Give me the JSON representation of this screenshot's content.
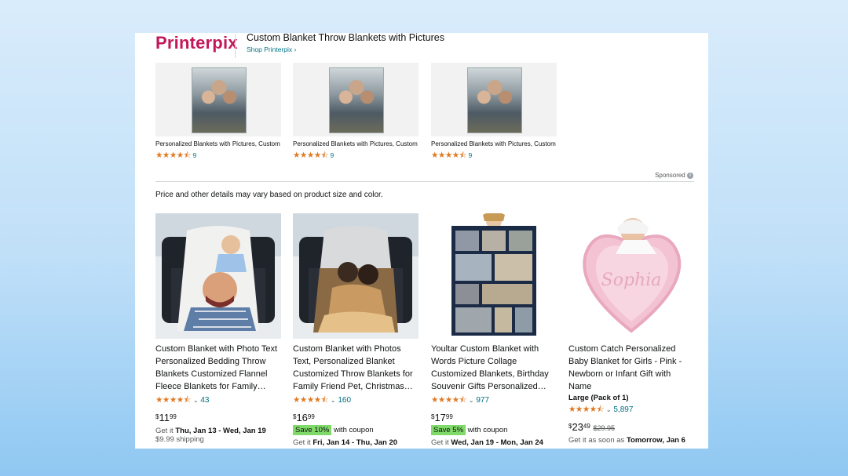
{
  "brand": {
    "logo_text": "Printerpix",
    "title": "Custom Blanket Throw Blankets with Pictures",
    "shop_link": "Shop Printerpix ›",
    "logo_color": "#c2185b"
  },
  "sponsored_items": [
    {
      "title": "Personalized Blankets with Pictures, Custom Throw Blanket, Soft Sherpa, for…",
      "stars": "★★★★⯪",
      "rating_count": "9"
    },
    {
      "title": "Personalized Blankets with Pictures, Custom Throw Blanket, Soft Sherpa, for…",
      "stars": "★★★★⯪",
      "rating_count": "9"
    },
    {
      "title": "Personalized Blankets with Pictures, Custom Throw Blanket, Soft Sherpa, for…",
      "stars": "★★★★⯪",
      "rating_count": "9"
    }
  ],
  "sponsored_label": "Sponsored",
  "info_icon": "i",
  "price_note": "Price and other details may vary based on product size and color.",
  "products": [
    {
      "title": "Custom Blanket with Photo Text Personalized Bedding Throw Blankets Customized Flannel Fleece Blankets for Family…",
      "stars": "★★★★⯪",
      "rating_count": "43",
      "price_symbol": "$",
      "price_whole": "11",
      "price_fraction": "99",
      "delivery_prefix": "Get it ",
      "delivery_dates": "Thu, Jan 13 - Wed, Jan 19",
      "shipping": "$9.99 shipping"
    },
    {
      "title": "Custom Blanket with Photos Text, Personalized Blanket Customized Throw Blankets for Family Friend Pet, Christmas…",
      "stars": "★★★★⯪",
      "rating_count": "160",
      "price_symbol": "$",
      "price_whole": "16",
      "price_fraction": "99",
      "coupon_badge": "Save 10%",
      "coupon_text": "with coupon",
      "delivery_prefix": "Get it ",
      "delivery_dates": "Fri, Jan 14 - Thu, Jan 20"
    },
    {
      "title": "Youltar Custom Blanket with Words Picture Collage Customized Blankets, Birthday Souvenir Gifts Personalized…",
      "stars": "★★★★⯪",
      "rating_count": "977",
      "price_symbol": "$",
      "price_whole": "17",
      "price_fraction": "99",
      "coupon_badge": "Save 5%",
      "coupon_text": "with coupon",
      "delivery_prefix": "Get it ",
      "delivery_dates": "Wed, Jan 19 - Mon, Jan 24"
    },
    {
      "title": "Custom Catch Personalized Baby Blanket for Girls - Pink - Newborn or Infant Gift with Name",
      "variant": "Large (Pack of 1)",
      "stars": "★★★★⯪",
      "rating_count": "5,897",
      "price_symbol": "$",
      "price_whole": "23",
      "price_fraction": "49",
      "list_price": "$29.95",
      "delivery_prefix": "Get it as soon as ",
      "delivery_dates": "Tomorrow, Jan 6",
      "blanket_name": "Sophia"
    }
  ],
  "colors": {
    "link": "#007185",
    "star": "#de7921",
    "coupon_badge": "#7fda69"
  }
}
